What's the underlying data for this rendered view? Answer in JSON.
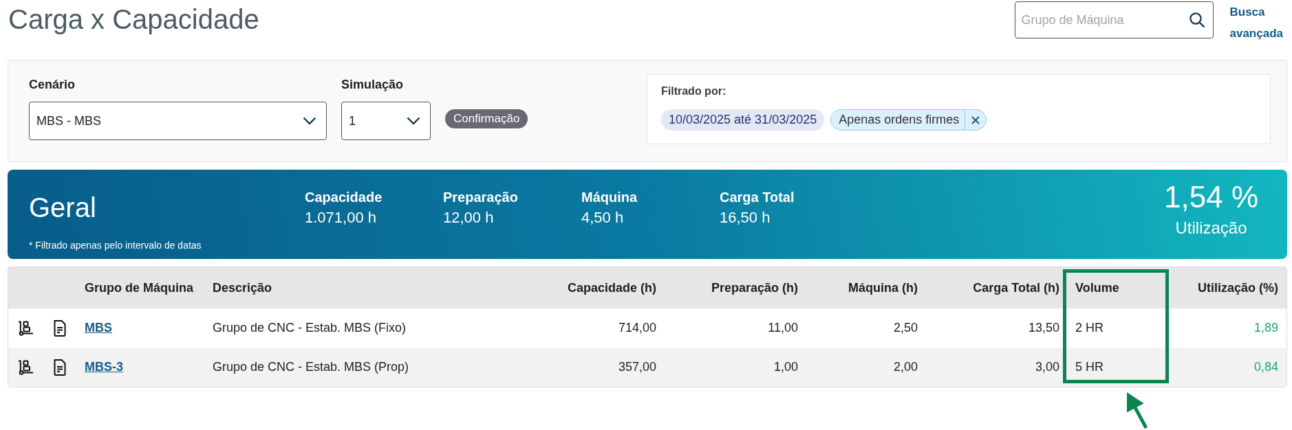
{
  "header": {
    "title": "Carga x Capacidade",
    "search": {
      "placeholder": "Grupo de Máquina"
    },
    "advanced_search_link": "Busca avançada"
  },
  "filters": {
    "fields": [
      {
        "label": "Cenário",
        "value": "MBS - MBS"
      },
      {
        "label": "Simulação",
        "value": "1"
      }
    ],
    "status_badge": "Confirmação",
    "applied": {
      "title": "Filtrado por:",
      "chips": [
        {
          "kind": "date",
          "label": "10/03/2025 até 31/03/2025",
          "removable": false
        },
        {
          "kind": "option",
          "label": "Apenas ordens firmes",
          "removable": true
        }
      ]
    }
  },
  "summary": {
    "title": "Geral",
    "note": "* Filtrado apenas pelo intervalo de datas",
    "stats": [
      {
        "label": "Capacidade",
        "value": "1.071,00 h"
      },
      {
        "label": "Preparação",
        "value": "12,00 h"
      },
      {
        "label": "Máquina",
        "value": "4,50 h"
      },
      {
        "label": "Carga Total",
        "value": "16,50 h"
      }
    ],
    "utilization": {
      "value": "1,54 %",
      "label": "Utilização"
    }
  },
  "table": {
    "columns": [
      {
        "label": "Grupo de Máquina",
        "kind": "link",
        "highlighted": false
      },
      {
        "label": "Descrição",
        "kind": "text",
        "highlighted": false
      },
      {
        "label": "Capacidade (h)",
        "kind": "number",
        "highlighted": false
      },
      {
        "label": "Preparação (h)",
        "kind": "number",
        "highlighted": false
      },
      {
        "label": "Máquina (h)",
        "kind": "number",
        "highlighted": false
      },
      {
        "label": "Carga Total (h)",
        "kind": "number",
        "highlighted": false
      },
      {
        "label": "Volume",
        "kind": "text",
        "highlighted": true
      },
      {
        "label": "Utilização (%)",
        "kind": "utilization",
        "highlighted": false
      }
    ],
    "rows": [
      {
        "cells": [
          "MBS",
          "Grupo de CNC - Estab. MBS (Fixo)",
          "714,00",
          "11,00",
          "2,50",
          "13,50",
          "2 HR",
          "1,89"
        ]
      },
      {
        "cells": [
          "MBS-3",
          "Grupo de CNC - Estab. MBS (Prop)",
          "357,00",
          "1,00",
          "2,00",
          "3,00",
          "5 HR",
          "0,84"
        ]
      }
    ]
  }
}
